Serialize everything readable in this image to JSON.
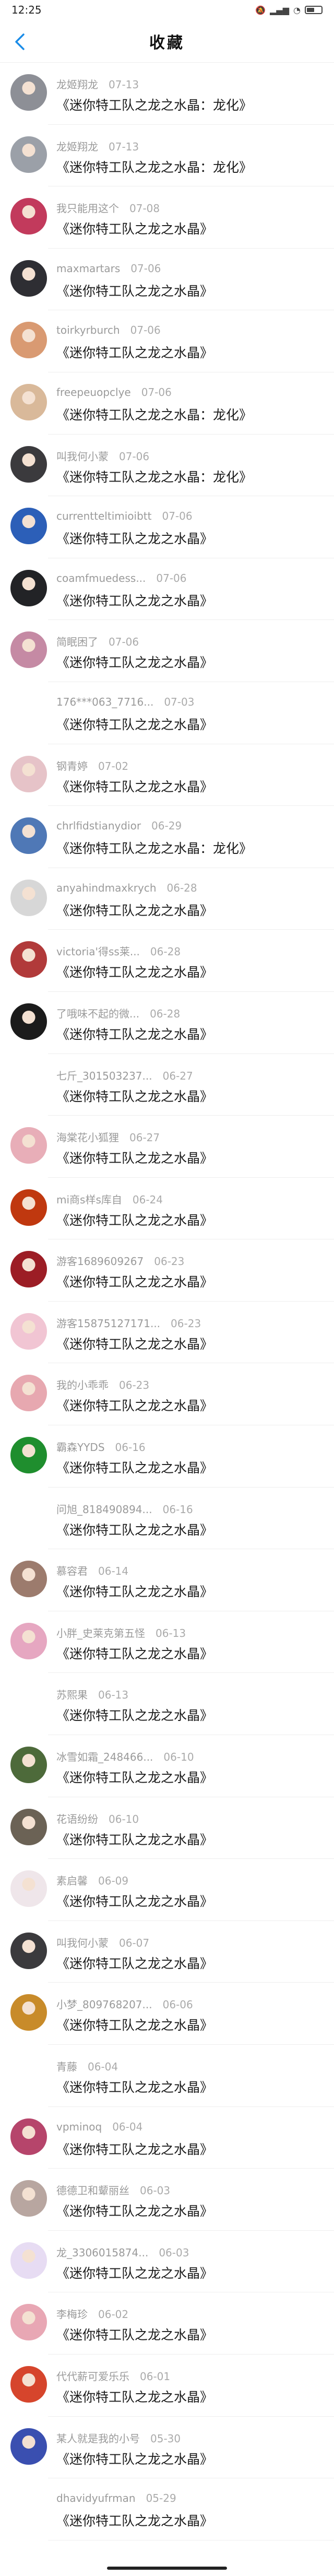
{
  "status_bar": {
    "time": "12:25",
    "icons": [
      "mute-icon",
      "signal-icon",
      "wifi-icon",
      "battery-icon"
    ]
  },
  "header": {
    "title": "收藏",
    "back_icon": "chevron-left-icon"
  },
  "colors": {
    "accent": "#1a8ce8",
    "meta": "#9a9a9a",
    "text": "#1a1a1a",
    "divider": "#eeeeee"
  },
  "items": [
    {
      "user": "龙姬翔龙",
      "date": "07-13",
      "title": "《迷你特工队之龙之水晶：龙化》",
      "avatar": "#8d8f96"
    },
    {
      "user": "龙姬翔龙",
      "date": "07-13",
      "title": "《迷你特工队之龙之水晶：龙化》",
      "avatar": "#9ba0a8"
    },
    {
      "user": "我只能用这个",
      "date": "07-08",
      "title": "《迷你特工队之龙之水晶》",
      "avatar": "#c23a5c"
    },
    {
      "user": "maxmartars",
      "date": "07-06",
      "title": "《迷你特工队之龙之水晶》",
      "avatar": "#2e2e33"
    },
    {
      "user": "toirkyrburch",
      "date": "07-06",
      "title": "《迷你特工队之龙之水晶》",
      "avatar": "#d99a72"
    },
    {
      "user": "freepeuopclye",
      "date": "07-06",
      "title": "《迷你特工队之龙之水晶：龙化》",
      "avatar": "#d9b99a"
    },
    {
      "user": "叫我何小蒙",
      "date": "07-06",
      "title": "《迷你特工队之龙之水晶：龙化》",
      "avatar": "#3b3a3d"
    },
    {
      "user": "currentteltimioibtt",
      "date": "07-06",
      "title": "《迷你特工队之龙之水晶》",
      "avatar": "#2c5fb8"
    },
    {
      "user": "coamfmuedess...",
      "date": "07-06",
      "title": "《迷你特工队之龙之水晶》",
      "avatar": "#222326"
    },
    {
      "user": "简眠困了",
      "date": "07-06",
      "title": "《迷你特工队之龙之水晶》",
      "avatar": "#c58aa4"
    },
    {
      "user": "176***063_7716...",
      "date": "07-03",
      "title": "《迷你特工队之龙之水晶》",
      "avatar": ""
    },
    {
      "user": "钢青婷",
      "date": "07-02",
      "title": "《迷你特工队之龙之水晶》",
      "avatar": "#e6c3c8"
    },
    {
      "user": "chrlfidstianydior",
      "date": "06-29",
      "title": "《迷你特工队之龙之水晶：龙化》",
      "avatar": "#4f78b6"
    },
    {
      "user": "anyahindmaxkrych",
      "date": "06-28",
      "title": "《迷你特工队之龙之水晶》",
      "avatar": "#d7d7d7"
    },
    {
      "user": "victoria'得ss莱...",
      "date": "06-28",
      "title": "《迷你特工队之龙之水晶》",
      "avatar": "#b13a3a"
    },
    {
      "user": "了哦味不起的微...",
      "date": "06-28",
      "title": "《迷你特工队之龙之水晶》",
      "avatar": "#1b1b1b"
    },
    {
      "user": "七斤_301503237...",
      "date": "06-27",
      "title": "《迷你特工队之龙之水晶》",
      "avatar": ""
    },
    {
      "user": "海棠花小狐狸",
      "date": "06-27",
      "title": "《迷你特工队之龙之水晶》",
      "avatar": "#e8aeb8"
    },
    {
      "user": "mi商s样s库自",
      "date": "06-24",
      "title": "《迷你特工队之龙之水晶》",
      "avatar": "#c0380f"
    },
    {
      "user": "游客1689609267",
      "date": "06-23",
      "title": "《迷你特工队之龙之水晶》",
      "avatar": "#9c1d25"
    },
    {
      "user": "游客15875127171...",
      "date": "06-23",
      "title": "《迷你特工队之龙之水晶》",
      "avatar": "#f1c5d3"
    },
    {
      "user": "我的小乖乖",
      "date": "06-23",
      "title": "《迷你特工队之龙之水晶》",
      "avatar": "#e7a8b0"
    },
    {
      "user": "霸森YYDS",
      "date": "06-16",
      "title": "《迷你特工队之龙之水晶》",
      "avatar": "#1f8e2e"
    },
    {
      "user": "问旭_818490894...",
      "date": "06-16",
      "title": "《迷你特工队之龙之水晶》",
      "avatar": ""
    },
    {
      "user": "慕容君",
      "date": "06-14",
      "title": "《迷你特工队之龙之水晶》",
      "avatar": "#9c7b6d"
    },
    {
      "user": "小胖_史莱克第五怪",
      "date": "06-13",
      "title": "《迷你特工队之龙之水晶》",
      "avatar": "#e6a7c1"
    },
    {
      "user": "苏熙果",
      "date": "06-13",
      "title": "《迷你特工队之龙之水晶》",
      "avatar": ""
    },
    {
      "user": "冰雪如霜_248466...",
      "date": "06-10",
      "title": "《迷你特工队之龙之水晶》",
      "avatar": "#4d6a3a"
    },
    {
      "user": "花语纷纷",
      "date": "06-10",
      "title": "《迷你特工队之龙之水晶》",
      "avatar": "#6b6255"
    },
    {
      "user": "素启馨",
      "date": "06-09",
      "title": "《迷你特工队之龙之水晶》",
      "avatar": "#efe6ea"
    },
    {
      "user": "叫我何小蒙",
      "date": "06-07",
      "title": "《迷你特工队之龙之水晶》",
      "avatar": "#3b3a3d"
    },
    {
      "user": "小梦_809768207...",
      "date": "06-06",
      "title": "《迷你特工队之龙之水晶》",
      "avatar": "#c88b2a"
    },
    {
      "user": "青藤",
      "date": "06-04",
      "title": "《迷你特工队之龙之水晶》",
      "avatar": ""
    },
    {
      "user": "vpminoq",
      "date": "06-04",
      "title": "《迷你特工队之龙之水晶》",
      "avatar": "#b6456b"
    },
    {
      "user": "德德卫和颦丽丝",
      "date": "06-03",
      "title": "《迷你特工队之龙之水晶》",
      "avatar": "#b8a6a0"
    },
    {
      "user": "龙_3306015874...",
      "date": "06-03",
      "title": "《迷你特工队之龙之水晶》",
      "avatar": "#e7dcf3"
    },
    {
      "user": "李梅珍",
      "date": "06-02",
      "title": "《迷你特工队之龙之水晶》",
      "avatar": "#e8a7b4"
    },
    {
      "user": "代代薪可爱乐乐",
      "date": "06-01",
      "title": "《迷你特工队之龙之水晶》",
      "avatar": "#d6452c"
    },
    {
      "user": "某人就是我的小号",
      "date": "05-30",
      "title": "《迷你特工队之龙之水晶》",
      "avatar": "#3a4fb0"
    },
    {
      "user": "dhavidyufrman",
      "date": "05-29",
      "title": "《迷你特工队之龙之水晶》",
      "avatar": ""
    }
  ]
}
